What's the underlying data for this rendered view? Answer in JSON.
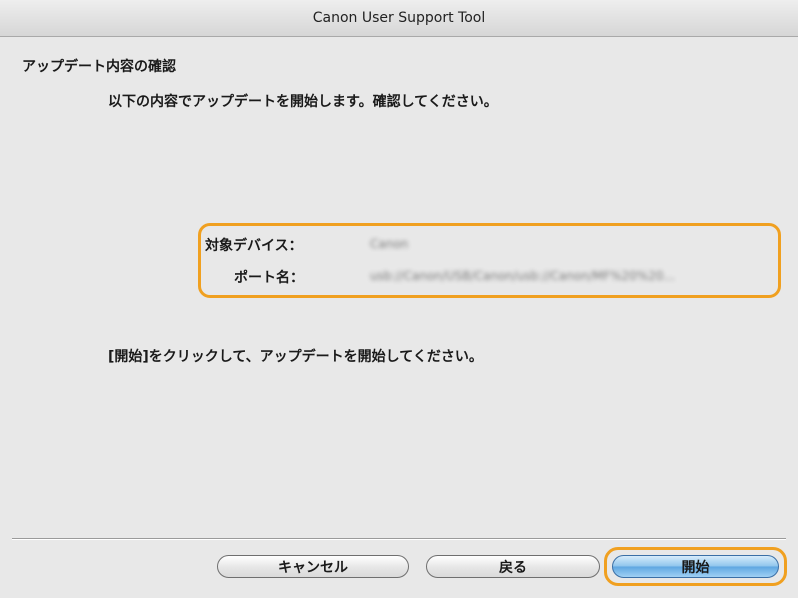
{
  "window": {
    "title": "Canon User Support Tool"
  },
  "main": {
    "heading": "アップデート内容の確認",
    "intro": "以下の内容でアップデートを開始します。確認してください。",
    "device_label": "対象デバイス：",
    "device_value": "Canon",
    "port_label": "ポート名：",
    "port_value": "usb://Canon/USB/Canon/usb://Canon/MF%20%20...",
    "instruction": "[開始]をクリックして、アップデートを開始してください。"
  },
  "buttons": {
    "cancel": "キャンセル",
    "back": "戻る",
    "start": "開始"
  },
  "colors": {
    "highlight": "#f0a020",
    "default_button": "#5ea6e1"
  }
}
